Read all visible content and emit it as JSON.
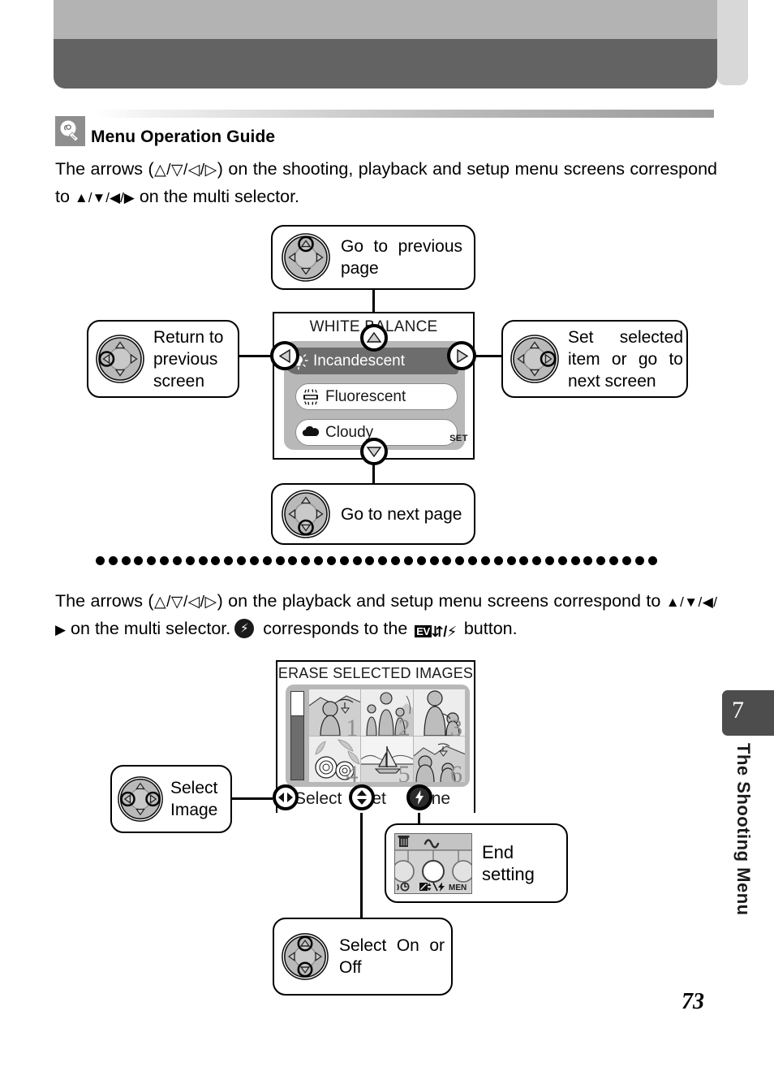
{
  "page": {
    "number": "73",
    "chapter_tab_number": "7",
    "chapter_title": "The Shooting Menu"
  },
  "tip": {
    "icon": "lightbulb-icon",
    "heading": "Menu Operation Guide"
  },
  "paragraphs": {
    "para1_prefix": "The arrows (",
    "para1_outline_arrows": "△/▽/◁/▷",
    "para1_mid": ") on the shooting, playback and setup menu screens correspond to ",
    "para1_filled_arrows": "▲/▼/◀/▶",
    "para1_suffix": " on the multi selector.",
    "para2_prefix": "The arrows (",
    "para2_outline_arrows": "△/▽/◁/▷",
    "para2_mid": ") on the playback and setup menu screens correspond to ",
    "para2_filled_arrows": "▲/▼/◀/▶",
    "para2_after_arrows": " on the multi selector.",
    "para2_flash_text": " corresponds to the ",
    "para2_ev_label": "EV",
    "para2_suffix": " button."
  },
  "callouts": {
    "go_previous_page": "Go to previous page",
    "return_previous_screen": "Return to previous screen",
    "set_selected_item": "Set selected item or go to next screen",
    "go_next_page": "Go to next page",
    "select_image": "Select Image",
    "end_setting": "End setting",
    "select_on_or_off": "Select On or Off"
  },
  "white_balance_screen": {
    "title": "WHITE BALANCE",
    "set_hint": "SET",
    "options": [
      {
        "label": "Incandescent",
        "icon": "incandescent-bulb-icon",
        "selected": true
      },
      {
        "label": "Fluorescent",
        "icon": "fluorescent-tube-icon",
        "selected": false
      },
      {
        "label": "Cloudy",
        "icon": "cloud-icon",
        "selected": false
      }
    ]
  },
  "erase_screen": {
    "title": "ERASE SELECTED IMAGES",
    "thumbnails": [
      {
        "number": "1",
        "scene": "person-with-umbrella",
        "selected": false
      },
      {
        "number": "2",
        "scene": "adult-with-children",
        "selected": false
      },
      {
        "number": "3",
        "scene": "woman-with-child",
        "selected": false
      },
      {
        "number": "4",
        "scene": "flowers",
        "selected": false
      },
      {
        "number": "5",
        "scene": "sailboat-on-water",
        "selected": true
      },
      {
        "number": "6",
        "scene": "people-outdoors",
        "selected": false
      }
    ],
    "hints": [
      {
        "icon": "left-right-arrows-icon",
        "label": "Select"
      },
      {
        "icon": "up-down-arrows-icon",
        "label": "Set"
      },
      {
        "icon": "flash-bolt-icon",
        "label": "Done"
      }
    ]
  },
  "camera_graphic": {
    "trash_icon": "trash-can-icon",
    "transfer_icon": "transfer-mark-icon",
    "selftimer_icon": "self-timer-icon",
    "ev_flash_icon": "ev-flash-icon",
    "menu_label": "MENU"
  },
  "colors": {
    "header_light": "#b3b3b3",
    "header_dark": "#636363",
    "lcd_panel_gray": "#b8b8b8",
    "lcd_selected_row": "#6d6d6d",
    "tab_dark": "#4d4d4d",
    "ink": "#000000"
  }
}
